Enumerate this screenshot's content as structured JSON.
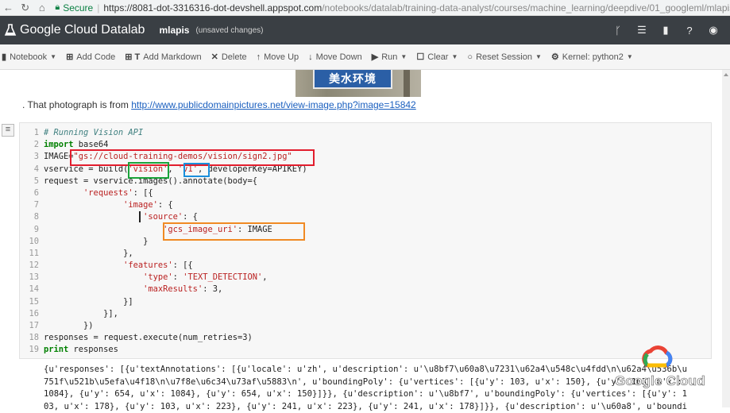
{
  "browser": {
    "secure_label": "Secure",
    "url_host": "https://8081-dot-3316316-dot-devshell.appspot.com",
    "url_path": "/notebooks/datalab/training-data-analyst/courses/machine_learning/deepdive/01_googleml/mlapis.ipy..."
  },
  "header": {
    "app_title": "Google Cloud Datalab",
    "notebook_name": "mlapis",
    "notebook_status": "(unsaved changes)"
  },
  "toolbar": {
    "notebook": "Notebook",
    "add_code": "Add Code",
    "add_markdown": "Add Markdown",
    "delete": "Delete",
    "move_up": "Move Up",
    "move_down": "Move Down",
    "run": "Run",
    "clear": "Clear",
    "reset_session": "Reset Session",
    "kernel": "Kernel: python2"
  },
  "markdown": {
    "sign_text": "美水环境",
    "prefix": ". That photograph is from ",
    "link": "http://www.publicdomainpictures.net/view-image.php?image=15842"
  },
  "code": {
    "line_numbers": [
      "1",
      "2",
      "3",
      "4",
      "5",
      "6",
      "7",
      "8",
      "9",
      "10",
      "11",
      "12",
      "13",
      "14",
      "15",
      "16",
      "17",
      "18",
      "19"
    ],
    "l1": "# Running Vision API",
    "l2_kw": "import",
    "l2_rest": " base64",
    "l3_a": "IMAGE=",
    "l3_str": "\"gs://cloud-training-demos/vision/sign2.jpg\"",
    "l4_a": "vservice = build(",
    "l4_s1": "'vision'",
    "l4_b": ", ",
    "l4_s2": "'v1'",
    "l4_c": ", developerKey=APIKEY)",
    "l5": "request = vservice.images().annotate(body={",
    "l6_a": "        ",
    "l6_s": "'requests'",
    "l6_b": ": [{",
    "l7_a": "                ",
    "l7_s": "'image'",
    "l7_b": ": {",
    "l8_a": "                    ",
    "l8_s": "'source'",
    "l8_b": ": {",
    "l9_a": "                        ",
    "l9_s": "'gcs_image_uri'",
    "l9_b": ": IMAGE",
    "l10": "                    }",
    "l11": "                },",
    "l12_a": "                ",
    "l12_s": "'features'",
    "l12_b": ": [{",
    "l13_a": "                    ",
    "l13_s1": "'type'",
    "l13_b": ": ",
    "l13_s2": "'TEXT_DETECTION'",
    "l13_c": ",",
    "l14_a": "                    ",
    "l14_s": "'maxResults'",
    "l14_b": ": 3,",
    "l15": "                }]",
    "l16": "            }],",
    "l17": "        })",
    "l18": "responses = request.execute(num_retries=3)",
    "l19_kw": "print",
    "l19_rest": " responses"
  },
  "output": {
    "lines": [
      "{u'responses': [{u'textAnnotations': [{u'locale': u'zh', u'description': u'\\u8bf7\\u60a8\\u7231\\u62a4\\u548c\\u4fdd\\n\\u62a4\\u536b\\u",
      "751f\\u521b\\u5efa\\u4f18\\n\\u7f8e\\u6c34\\u73af\\u5883\\n', u'boundingPoly': {u'vertices': [{u'y': 103, u'x': 150}, {u'y': 103, u'x':",
      "1084}, {u'y': 654, u'x': 1084}, {u'y': 654, u'x': 150}]}}, {u'description': u'\\u8bf7', u'boundingPoly': {u'vertices': [{u'y': 1",
      "03, u'x': 178}, {u'y': 103, u'x': 223}, {u'y': 241, u'x': 223}, {u'y': 241, u'x': 178}]}}, {u'description': u'\\u60a8', u'boundi"
    ]
  },
  "watermark": {
    "text": "Google Cloud"
  },
  "colors": {
    "highlight_red": "#e21d2d",
    "highlight_green": "#1aa33a",
    "highlight_blue": "#1a8fdc",
    "highlight_orange": "#f08a24",
    "header_bg": "#3a3f44"
  },
  "icons": {
    "back": "back-arrow-icon",
    "reload": "reload-icon",
    "home": "home-icon",
    "lock": "lock-icon",
    "logo": "datalab-logo-icon",
    "branch": "branch-icon",
    "list": "list-icon",
    "bookmark": "bookmark-icon",
    "help": "help-icon",
    "account": "account-icon"
  }
}
